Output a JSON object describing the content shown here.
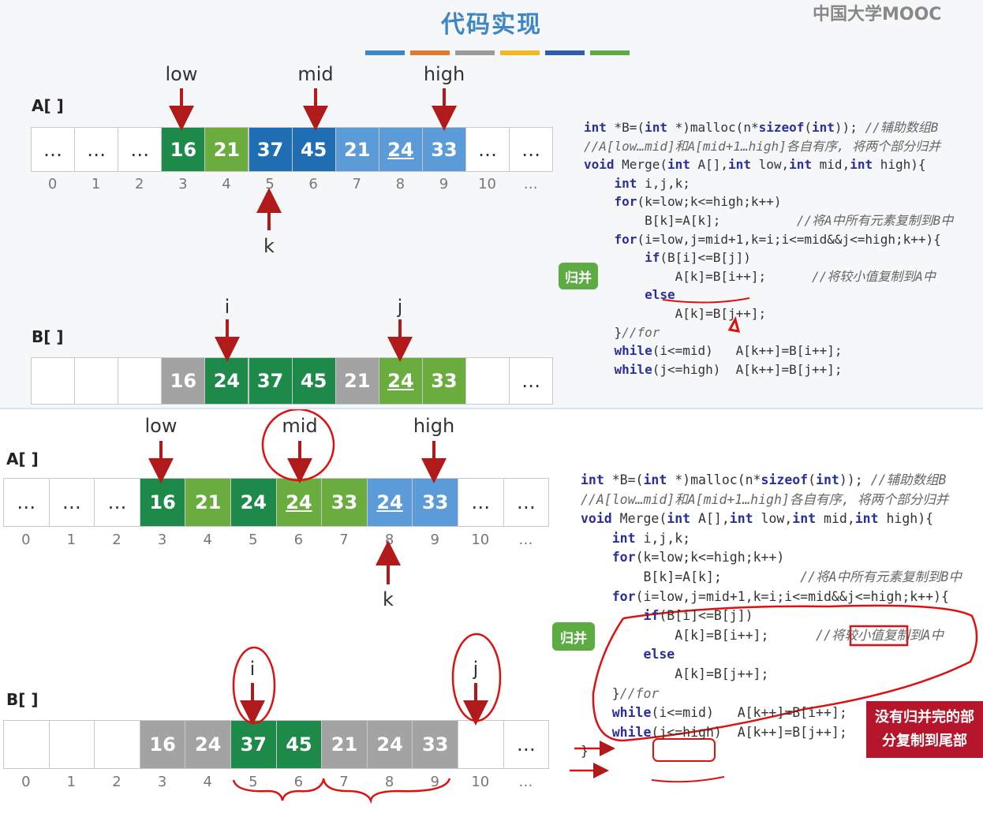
{
  "top": {
    "title": "代码实现",
    "logo": "中国大学MOOC",
    "stripe_colors": [
      "#3f86c5",
      "#e07a2e",
      "#9a9a9a",
      "#f2b824",
      "#2f5fa8",
      "#5cab43"
    ],
    "array_A_name": "A[ ]",
    "array_B_name": "B[ ]",
    "pointers_A": {
      "low": "low",
      "mid": "mid",
      "high": "high",
      "k": "k"
    },
    "pointers_B": {
      "i": "i",
      "j": "j"
    },
    "A_cells": [
      {
        "v": "…",
        "c": "empty"
      },
      {
        "v": "…",
        "c": "empty"
      },
      {
        "v": "…",
        "c": "empty"
      },
      {
        "v": "16",
        "c": "c-dg"
      },
      {
        "v": "21",
        "c": "c-lg"
      },
      {
        "v": "37",
        "c": "c-db"
      },
      {
        "v": "45",
        "c": "c-db"
      },
      {
        "v": "21",
        "c": "c-lb"
      },
      {
        "v": "24",
        "c": "c-lb",
        "u": true
      },
      {
        "v": "33",
        "c": "c-lb"
      },
      {
        "v": "…",
        "c": "empty"
      },
      {
        "v": "…",
        "c": "empty"
      }
    ],
    "B_cells": [
      {
        "v": "",
        "c": "empty"
      },
      {
        "v": "",
        "c": "empty"
      },
      {
        "v": "",
        "c": "empty"
      },
      {
        "v": "16",
        "c": "c-gr"
      },
      {
        "v": "24",
        "c": "c-dg"
      },
      {
        "v": "37",
        "c": "c-dg"
      },
      {
        "v": "45",
        "c": "c-dg"
      },
      {
        "v": "21",
        "c": "c-gr"
      },
      {
        "v": "24",
        "c": "c-lg",
        "u": true
      },
      {
        "v": "33",
        "c": "c-lg"
      },
      {
        "v": "",
        "c": "empty"
      },
      {
        "v": "…",
        "c": "empty"
      }
    ],
    "indices": [
      "0",
      "1",
      "2",
      "3",
      "4",
      "5",
      "6",
      "7",
      "8",
      "9",
      "10",
      "…"
    ],
    "tag": "归并",
    "code": [
      "int *B=(int *)malloc(n*sizeof(int)); //辅助数组B",
      "//A[low…mid]和A[mid+1…high]各自有序, 将两个部分归并",
      "void Merge(int A[],int low,int mid,int high){",
      "    int i,j,k;",
      "    for(k=low;k<=high;k++)",
      "        B[k]=A[k];          //将A中所有元素复制到B中",
      "    for(i=low,j=mid+1,k=i;i<=mid&&j<=high;k++){",
      "        if(B[i]<=B[j])",
      "            A[k]=B[i++];      //将较小值复制到A中",
      "        else",
      "            A[k]=B[j++];",
      "    }//for",
      "    while(i<=mid)   A[k++]=B[i++];",
      "    while(j<=high)  A[k++]=B[j++];"
    ]
  },
  "bottom": {
    "array_A_name": "A[ ]",
    "array_B_name": "B[ ]",
    "pointers_A": {
      "low": "low",
      "mid": "mid",
      "high": "high",
      "k": "k"
    },
    "pointers_B": {
      "i": "i",
      "j": "j"
    },
    "A_cells": [
      {
        "v": "…",
        "c": "empty"
      },
      {
        "v": "…",
        "c": "empty"
      },
      {
        "v": "…",
        "c": "empty"
      },
      {
        "v": "16",
        "c": "c-dg"
      },
      {
        "v": "21",
        "c": "c-lg"
      },
      {
        "v": "24",
        "c": "c-dg"
      },
      {
        "v": "24",
        "c": "c-lg",
        "u": true
      },
      {
        "v": "33",
        "c": "c-lg"
      },
      {
        "v": "24",
        "c": "c-lb",
        "u": true
      },
      {
        "v": "33",
        "c": "c-lb"
      },
      {
        "v": "…",
        "c": "empty"
      },
      {
        "v": "…",
        "c": "empty"
      }
    ],
    "B_cells": [
      {
        "v": "",
        "c": "empty"
      },
      {
        "v": "",
        "c": "empty"
      },
      {
        "v": "",
        "c": "empty"
      },
      {
        "v": "16",
        "c": "c-gr"
      },
      {
        "v": "24",
        "c": "c-gr"
      },
      {
        "v": "37",
        "c": "c-dg"
      },
      {
        "v": "45",
        "c": "c-dg"
      },
      {
        "v": "21",
        "c": "c-gr"
      },
      {
        "v": "24",
        "c": "c-gr"
      },
      {
        "v": "33",
        "c": "c-gr"
      },
      {
        "v": "",
        "c": "empty"
      },
      {
        "v": "…",
        "c": "empty"
      }
    ],
    "indices": [
      "0",
      "1",
      "2",
      "3",
      "4",
      "5",
      "6",
      "7",
      "8",
      "9",
      "10",
      "…"
    ],
    "tag": "归并",
    "note_line1": "没有归并完的部",
    "note_line2": "分复制到尾部",
    "code": [
      "int *B=(int *)malloc(n*sizeof(int)); //辅助数组B",
      "//A[low…mid]和A[mid+1…high]各自有序, 将两个部分归并",
      "void Merge(int A[],int low,int mid,int high){",
      "    int i,j,k;",
      "    for(k=low;k<=high;k++)",
      "        B[k]=A[k];          //将A中所有元素复制到B中",
      "    for(i=low,j=mid+1,k=i;i<=mid&&j<=high;k++){",
      "        if(B[i]<=B[j])",
      "            A[k]=B[i++];      //将较小值复制到A中",
      "        else",
      "            A[k]=B[j++];",
      "    }//for",
      "    while(i<=mid)   A[k++]=B[i++];",
      "    while(j<=high)  A[k++]=B[j++];",
      "}"
    ]
  }
}
